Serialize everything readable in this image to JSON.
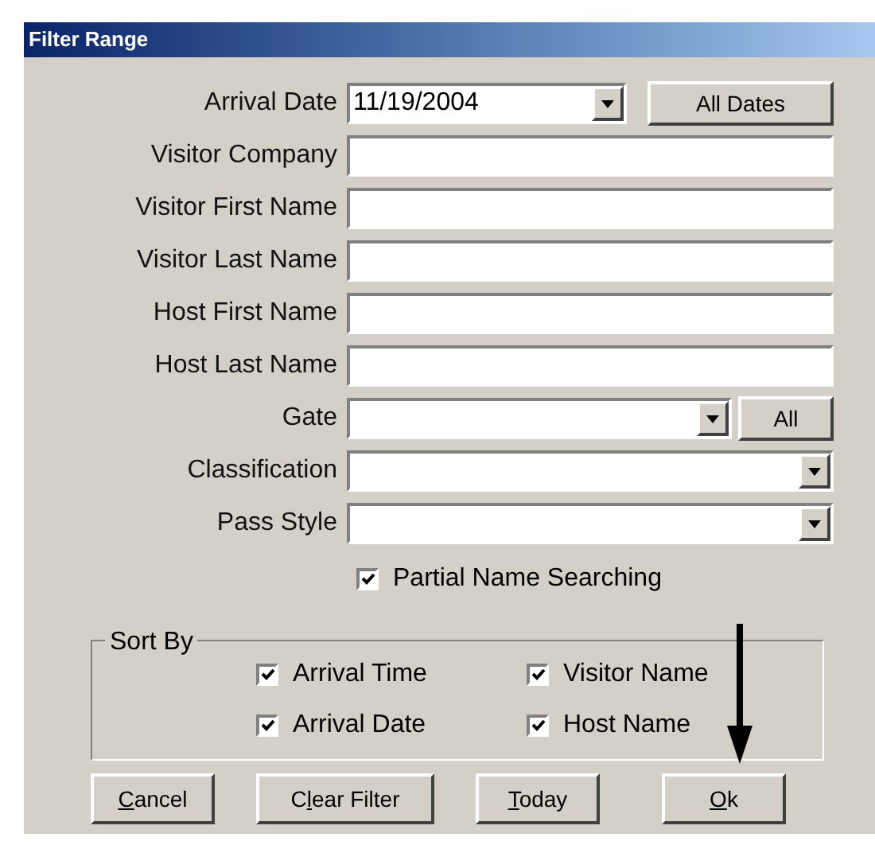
{
  "window": {
    "title": "Filter Range"
  },
  "fields": [
    {
      "kind": "date",
      "label": "Arrival Date",
      "value": "11/19/2004",
      "button": "All Dates"
    },
    {
      "kind": "text",
      "label": "Visitor Company"
    },
    {
      "kind": "text",
      "label": "Visitor First Name"
    },
    {
      "kind": "text",
      "label": "Visitor Last Name"
    },
    {
      "kind": "text",
      "label": "Host First Name"
    },
    {
      "kind": "text",
      "label": "Host Last Name"
    },
    {
      "kind": "combo_button",
      "label": "Gate",
      "button": "All"
    },
    {
      "kind": "combo",
      "label": "Classification"
    },
    {
      "kind": "combo",
      "label": "Pass Style"
    }
  ],
  "partial_name_searching": {
    "label": "Partial Name Searching",
    "checked": true
  },
  "sort_by": {
    "title": "Sort By",
    "options": [
      {
        "label": "Arrival Time",
        "checked": true
      },
      {
        "label": "Visitor Name",
        "checked": true
      },
      {
        "label": "Arrival Date",
        "checked": true
      },
      {
        "label": "Host Name",
        "checked": true
      }
    ]
  },
  "buttons": [
    {
      "label": "Cancel",
      "kind": "first"
    },
    {
      "label": "Clear Filter",
      "kind": "second"
    },
    {
      "label": "Today",
      "kind": "first"
    },
    {
      "label": "Ok",
      "kind": "first"
    }
  ]
}
